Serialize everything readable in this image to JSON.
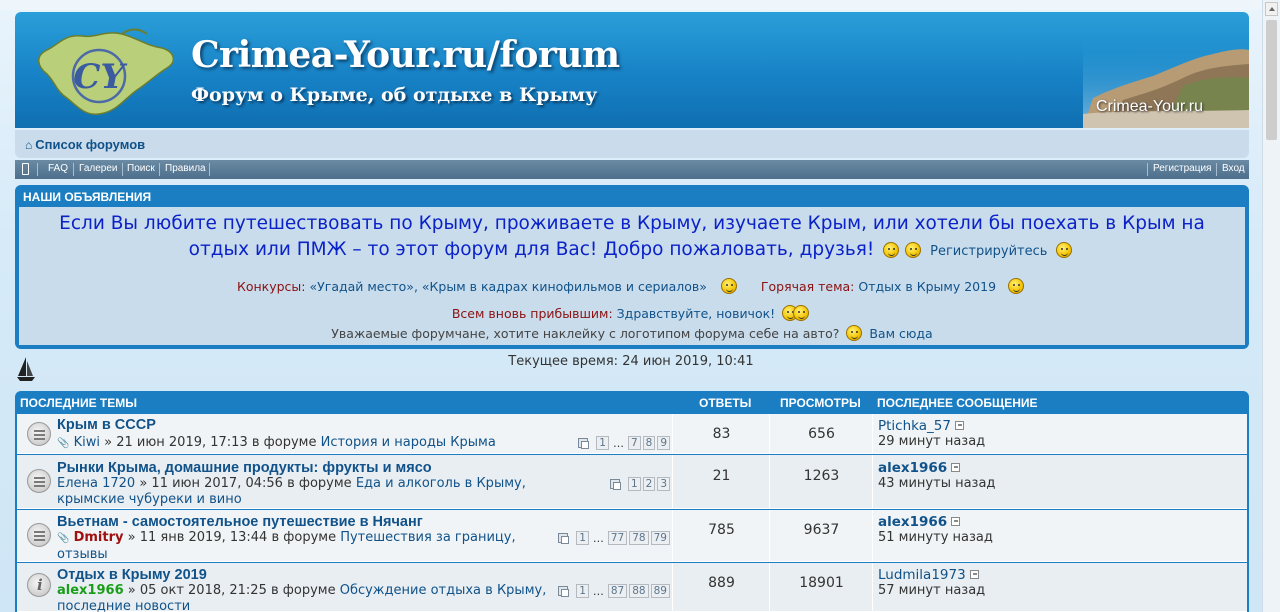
{
  "header": {
    "title": "Crimea-Your.ru/forum",
    "subtitle": "Форум о Крыме, об отдыхе в Крыму",
    "logo_text": "CY",
    "corner_label": "Crimea-Your.ru"
  },
  "nav": {
    "forum_index": "Список форумов",
    "menu": [
      "FAQ",
      "Галереи",
      "Поиск",
      "Правила"
    ],
    "register": "Регистрация",
    "login": "Вход"
  },
  "announce": {
    "heading": "НАШИ ОБЪЯВЛЕНИЯ",
    "main": "Если Вы любите путешествовать по Крыму, проживаете в Крыму, изучаете Крым, или хотели бы поехать в Крым на отдых или ПМЖ – то этот форум для Вас! Добро пожаловать, друзья!",
    "register_link": "Регистрируйтесь",
    "contests_label": "Конкурсы:",
    "contests": "«Угадай место», «Крым в кадрах кинофильмов и сериалов»",
    "hot_label": "Горячая тема:",
    "hot": "Отдых в Крыму 2019",
    "newcomers_label": "Всем вновь прибывшим:",
    "newcomers": "Здравствуйте, новичок!",
    "sticker_text": "Уважаемые форумчане, хотите наклейку с логотипом форума себе на авто?",
    "sticker_link": "Вам сюда"
  },
  "current_time": "Текущее время: 24 июн 2019, 10:41",
  "topics_table": {
    "headers": {
      "topics": "ПОСЛЕДНИЕ ТЕМЫ",
      "replies": "ОТВЕТЫ",
      "views": "ПРОСМОТРЫ",
      "last": "ПОСЛЕДНЕЕ СООБЩЕНИЕ"
    },
    "rows": [
      {
        "title": "Крым в СССР",
        "author": "Kiwi",
        "meta": " » 21 июн 2019, 17:13 в форуме ",
        "forum": "История и народы Крыма",
        "pages": [
          "1",
          "7",
          "8",
          "9"
        ],
        "replies": "83",
        "views": "656",
        "last_author": "Ptichka_57",
        "last_time": "29 минут назад"
      },
      {
        "title": "Рынки Крыма, домашние продукты: фрукты и мясо",
        "author": "Елена 1720",
        "meta": " » 11 июн 2017, 04:56 в форуме ",
        "forum": "Еда и алкоголь в Крыму, крымские чубуреки и вино",
        "pages": [
          "1",
          "2",
          "3"
        ],
        "replies": "21",
        "views": "1263",
        "last_author": "alex1966",
        "last_time": "43 минуты назад"
      },
      {
        "title": "Вьетнам - самостоятельное путешествие в Нячанг",
        "author": "Dmitry",
        "meta": " » 11 янв 2019, 13:44 в форуме ",
        "forum": "Путешествия за границу, отзывы",
        "pages": [
          "1",
          "77",
          "78",
          "79"
        ],
        "replies": "785",
        "views": "9637",
        "last_author": "alex1966",
        "last_time": "51 минуту назад"
      },
      {
        "title": "Отдых в Крыму 2019",
        "author": "alex1966",
        "meta": " » 05 окт 2018, 21:25 в форуме ",
        "forum": "Обсуждение отдыха в Крыму, последние новости",
        "pages": [
          "1",
          "87",
          "88",
          "89"
        ],
        "replies": "889",
        "views": "18901",
        "last_author": "Ludmila1973",
        "last_time": "57 минут назад"
      }
    ]
  },
  "colors": {
    "header_blue": "#1782c6",
    "panel_bg": "#c9dcec",
    "link": "#105289",
    "announce_text": "#0a22c8",
    "green_user": "#1a9e1a",
    "red_user": "#a01010"
  }
}
